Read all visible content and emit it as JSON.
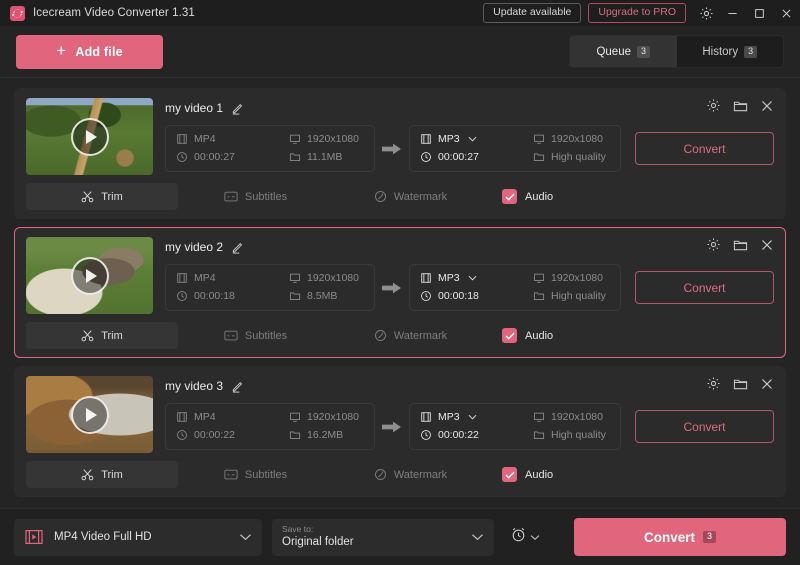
{
  "window": {
    "title": "Icecream Video Converter 1.31",
    "logo_icon": "icecream-logo-icon",
    "update_button": "Update available",
    "pro_button": "Upgrade to PRO",
    "settings_icon": "gear-icon",
    "minimize_icon": "minimize-icon",
    "maximize_icon": "maximize-icon",
    "close_icon": "close-icon",
    "accent_color": "#e2657e",
    "background_color": "#242424"
  },
  "toolbar": {
    "add_file_label": "Add file",
    "add_file_icon": "plus-icon",
    "tabs": [
      {
        "label": "Queue",
        "count": "3",
        "active": true
      },
      {
        "label": "History",
        "count": "3",
        "active": false
      }
    ]
  },
  "queue": {
    "items": [
      {
        "name": "my video 1",
        "edit_icon": "pencil-icon",
        "thumbnail": "video-thumbnail-safari-road",
        "play_icon": "play-icon",
        "source": {
          "format": "MP4",
          "resolution": "1920x1080",
          "duration": "00:00:27",
          "size": "11.1MB"
        },
        "target": {
          "format": "MP3",
          "resolution": "1920x1080",
          "duration": "00:00:27",
          "quality": "High quality"
        },
        "convert_label": "Convert",
        "tools": [
          "gear-icon",
          "folder-icon",
          "close-icon"
        ],
        "tabs": [
          {
            "label": "Trim",
            "icon": "scissors-icon",
            "active": true
          },
          {
            "label": "Subtitles",
            "icon": "cc-icon",
            "active": false
          },
          {
            "label": "Watermark",
            "icon": "watermark-icon",
            "active": false
          }
        ],
        "audio_label": "Audio",
        "audio_checked": true,
        "selected": false
      },
      {
        "name": "my video 2",
        "edit_icon": "pencil-icon",
        "thumbnail": "video-thumbnail-cheetah",
        "play_icon": "play-icon",
        "source": {
          "format": "MP4",
          "resolution": "1920x1080",
          "duration": "00:00:18",
          "size": "8.5MB"
        },
        "target": {
          "format": "MP3",
          "resolution": "1920x1080",
          "duration": "00:00:18",
          "quality": "High quality"
        },
        "convert_label": "Convert",
        "tools": [
          "gear-icon",
          "folder-icon",
          "close-icon"
        ],
        "tabs": [
          {
            "label": "Trim",
            "icon": "scissors-icon",
            "active": true
          },
          {
            "label": "Subtitles",
            "icon": "cc-icon",
            "active": false
          },
          {
            "label": "Watermark",
            "icon": "watermark-icon",
            "active": false
          }
        ],
        "audio_label": "Audio",
        "audio_checked": true,
        "selected": true
      },
      {
        "name": "my video 3",
        "edit_icon": "pencil-icon",
        "thumbnail": "video-thumbnail-lion",
        "play_icon": "play-icon",
        "source": {
          "format": "MP4",
          "resolution": "1920x1080",
          "duration": "00:00:22",
          "size": "16.2MB"
        },
        "target": {
          "format": "MP3",
          "resolution": "1920x1080",
          "duration": "00:00:22",
          "quality": "High quality"
        },
        "convert_label": "Convert",
        "tools": [
          "gear-icon",
          "folder-icon",
          "close-icon"
        ],
        "tabs": [
          {
            "label": "Trim",
            "icon": "scissors-icon",
            "active": true
          },
          {
            "label": "Subtitles",
            "icon": "cc-icon",
            "active": false
          },
          {
            "label": "Watermark",
            "icon": "watermark-icon",
            "active": false
          }
        ],
        "audio_label": "Audio",
        "audio_checked": true,
        "selected": false
      }
    ]
  },
  "footer": {
    "format_value": "MP4 Video Full HD",
    "format_icon": "film-play-icon",
    "format_caret": "chevron-down-icon",
    "save_to_label": "Save to:",
    "save_to_value": "Original folder",
    "save_caret": "chevron-down-icon",
    "alarm_icon": "alarm-clock-icon",
    "alarm_caret": "chevron-down-icon",
    "convert_label": "Convert",
    "convert_count": "3"
  }
}
